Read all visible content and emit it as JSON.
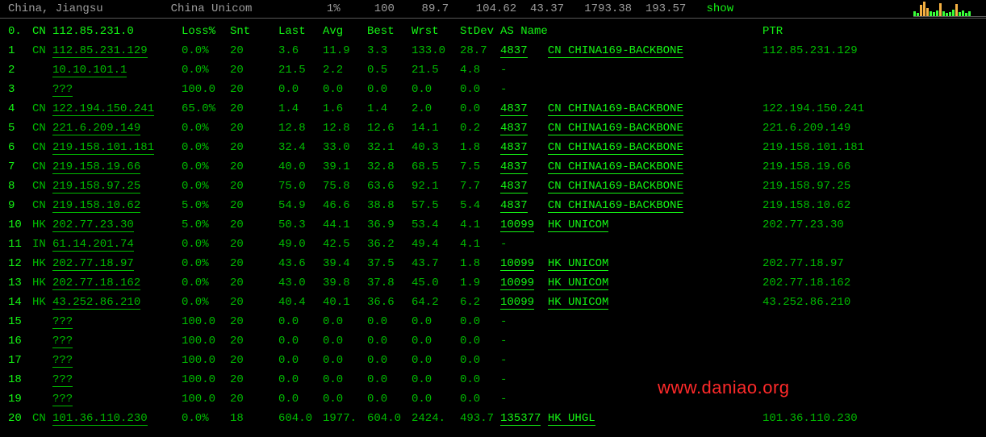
{
  "top": {
    "location": "China, Jiangsu",
    "isp": "China Unicom",
    "loss": "1%",
    "sent": "100",
    "v1": "89.7",
    "v2": "104.62",
    "v3": "43.37",
    "v4": "1793.38",
    "v5": "193.57",
    "show": "show"
  },
  "headers": {
    "hop": "0.",
    "cc": "CN",
    "ip": "112.85.231.0",
    "loss": "Loss%",
    "snt": "Snt",
    "last": "Last",
    "avg": "Avg",
    "best": "Best",
    "wrst": "Wrst",
    "stdev": "StDev",
    "asn": "AS Name",
    "ptr": "PTR"
  },
  "hops": [
    {
      "n": "1",
      "cc": "CN",
      "ip": "112.85.231.129",
      "u": true,
      "loss": "0.0%",
      "snt": "20",
      "last": "3.6",
      "avg": "11.9",
      "best": "3.3",
      "wrst": "133.0",
      "std": "28.7",
      "asn": "4837",
      "asname": "CN CHINA169-BACKBONE",
      "au": true,
      "ptr": "112.85.231.129"
    },
    {
      "n": "2",
      "cc": "",
      "ip": "10.10.101.1",
      "u": true,
      "loss": "0.0%",
      "snt": "20",
      "last": "21.5",
      "avg": "2.2",
      "best": "0.5",
      "wrst": "21.5",
      "std": "4.8",
      "asn": "-",
      "asname": "",
      "ptr": ""
    },
    {
      "n": "3",
      "cc": "",
      "ip": "???",
      "u": true,
      "loss": "100.0",
      "snt": "20",
      "last": "0.0",
      "avg": "0.0",
      "best": "0.0",
      "wrst": "0.0",
      "std": "0.0",
      "asn": "-",
      "asname": "",
      "ptr": ""
    },
    {
      "n": "4",
      "cc": "CN",
      "ip": "122.194.150.241",
      "u": true,
      "loss": "65.0%",
      "snt": "20",
      "last": "1.4",
      "avg": "1.6",
      "best": "1.4",
      "wrst": "2.0",
      "std": "0.0",
      "asn": "4837",
      "asname": "CN CHINA169-BACKBONE",
      "au": true,
      "ptr": "122.194.150.241"
    },
    {
      "n": "5",
      "cc": "CN",
      "ip": "221.6.209.149",
      "u": true,
      "loss": "0.0%",
      "snt": "20",
      "last": "12.8",
      "avg": "12.8",
      "best": "12.6",
      "wrst": "14.1",
      "std": "0.2",
      "asn": "4837",
      "asname": "CN CHINA169-BACKBONE",
      "au": true,
      "ptr": "221.6.209.149"
    },
    {
      "n": "6",
      "cc": "CN",
      "ip": "219.158.101.181",
      "u": true,
      "loss": "0.0%",
      "snt": "20",
      "last": "32.4",
      "avg": "33.0",
      "best": "32.1",
      "wrst": "40.3",
      "std": "1.8",
      "asn": "4837",
      "asname": "CN CHINA169-BACKBONE",
      "au": true,
      "ptr": "219.158.101.181"
    },
    {
      "n": "7",
      "cc": "CN",
      "ip": "219.158.19.66",
      "u": true,
      "loss": "0.0%",
      "snt": "20",
      "last": "40.0",
      "avg": "39.1",
      "best": "32.8",
      "wrst": "68.5",
      "std": "7.5",
      "asn": "4837",
      "asname": "CN CHINA169-BACKBONE",
      "au": true,
      "ptr": "219.158.19.66"
    },
    {
      "n": "8",
      "cc": "CN",
      "ip": "219.158.97.25",
      "u": true,
      "loss": "0.0%",
      "snt": "20",
      "last": "75.0",
      "avg": "75.8",
      "best": "63.6",
      "wrst": "92.1",
      "std": "7.7",
      "asn": "4837",
      "asname": "CN CHINA169-BACKBONE",
      "au": true,
      "ptr": "219.158.97.25"
    },
    {
      "n": "9",
      "cc": "CN",
      "ip": "219.158.10.62",
      "u": true,
      "loss": "5.0%",
      "snt": "20",
      "last": "54.9",
      "avg": "46.6",
      "best": "38.8",
      "wrst": "57.5",
      "std": "5.4",
      "asn": "4837",
      "asname": "CN CHINA169-BACKBONE",
      "au": true,
      "ptr": "219.158.10.62"
    },
    {
      "n": "10",
      "cc": "HK",
      "ip": "202.77.23.30",
      "u": true,
      "loss": "5.0%",
      "snt": "20",
      "last": "50.3",
      "avg": "44.1",
      "best": "36.9",
      "wrst": "53.4",
      "std": "4.1",
      "asn": "10099",
      "asname": "HK UNICOM",
      "au": true,
      "ptr": "202.77.23.30"
    },
    {
      "n": "11",
      "cc": "IN",
      "ip": "61.14.201.74",
      "u": true,
      "loss": "0.0%",
      "snt": "20",
      "last": "49.0",
      "avg": "42.5",
      "best": "36.2",
      "wrst": "49.4",
      "std": "4.1",
      "asn": "-",
      "asname": "",
      "ptr": ""
    },
    {
      "n": "12",
      "cc": "HK",
      "ip": "202.77.18.97",
      "u": true,
      "loss": "0.0%",
      "snt": "20",
      "last": "43.6",
      "avg": "39.4",
      "best": "37.5",
      "wrst": "43.7",
      "std": "1.8",
      "asn": "10099",
      "asname": "HK UNICOM",
      "au": true,
      "ptr": "202.77.18.97"
    },
    {
      "n": "13",
      "cc": "HK",
      "ip": "202.77.18.162",
      "u": true,
      "loss": "0.0%",
      "snt": "20",
      "last": "43.0",
      "avg": "39.8",
      "best": "37.8",
      "wrst": "45.0",
      "std": "1.9",
      "asn": "10099",
      "asname": "HK UNICOM",
      "au": true,
      "ptr": "202.77.18.162"
    },
    {
      "n": "14",
      "cc": "HK",
      "ip": "43.252.86.210",
      "u": true,
      "loss": "0.0%",
      "snt": "20",
      "last": "40.4",
      "avg": "40.1",
      "best": "36.6",
      "wrst": "64.2",
      "std": "6.2",
      "asn": "10099",
      "asname": "HK UNICOM",
      "au": true,
      "ptr": "43.252.86.210"
    },
    {
      "n": "15",
      "cc": "",
      "ip": "???",
      "u": true,
      "loss": "100.0",
      "snt": "20",
      "last": "0.0",
      "avg": "0.0",
      "best": "0.0",
      "wrst": "0.0",
      "std": "0.0",
      "asn": "-",
      "asname": "",
      "ptr": ""
    },
    {
      "n": "16",
      "cc": "",
      "ip": "???",
      "u": true,
      "loss": "100.0",
      "snt": "20",
      "last": "0.0",
      "avg": "0.0",
      "best": "0.0",
      "wrst": "0.0",
      "std": "0.0",
      "asn": "-",
      "asname": "",
      "ptr": ""
    },
    {
      "n": "17",
      "cc": "",
      "ip": "???",
      "u": true,
      "loss": "100.0",
      "snt": "20",
      "last": "0.0",
      "avg": "0.0",
      "best": "0.0",
      "wrst": "0.0",
      "std": "0.0",
      "asn": "-",
      "asname": "",
      "ptr": ""
    },
    {
      "n": "18",
      "cc": "",
      "ip": "???",
      "u": true,
      "loss": "100.0",
      "snt": "20",
      "last": "0.0",
      "avg": "0.0",
      "best": "0.0",
      "wrst": "0.0",
      "std": "0.0",
      "asn": "-",
      "asname": "",
      "ptr": ""
    },
    {
      "n": "19",
      "cc": "",
      "ip": "???",
      "u": true,
      "loss": "100.0",
      "snt": "20",
      "last": "0.0",
      "avg": "0.0",
      "best": "0.0",
      "wrst": "0.0",
      "std": "0.0",
      "asn": "-",
      "asname": "",
      "ptr": ""
    },
    {
      "n": "20",
      "cc": "CN",
      "ip": "101.36.110.230",
      "u": true,
      "loss": "0.0%",
      "snt": "18",
      "last": "604.0",
      "avg": "1977.",
      "best": "604.0",
      "wrst": "2424.",
      "std": "493.7",
      "asn": "135377",
      "asname": "HK UHGL",
      "au": true,
      "ptr": "101.36.110.230"
    }
  ],
  "watermark": "www.daniao.org"
}
